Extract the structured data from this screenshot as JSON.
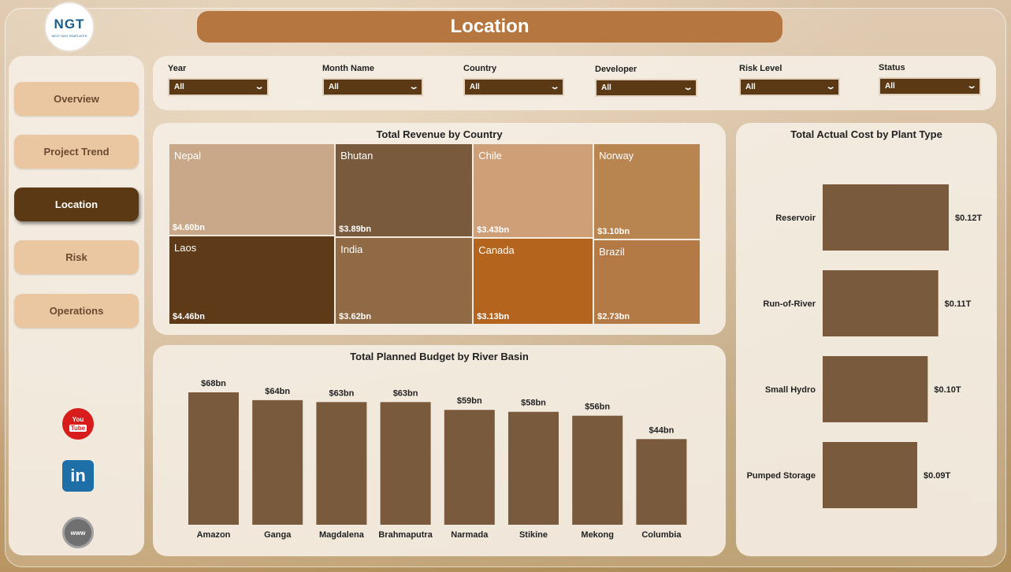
{
  "logo": {
    "text": "NGT",
    "subtext": "NEXT GEN TEMPLATES"
  },
  "header": {
    "title": "Location"
  },
  "sidebar": {
    "items": [
      {
        "label": "Overview",
        "active": false
      },
      {
        "label": "Project Trend",
        "active": false
      },
      {
        "label": "Location",
        "active": true
      },
      {
        "label": "Risk",
        "active": false
      },
      {
        "label": "Operations",
        "active": false
      }
    ],
    "social": [
      {
        "name": "youtube-icon",
        "line1": "You",
        "line2": "Tube"
      },
      {
        "name": "linkedin-icon",
        "text": "in"
      },
      {
        "name": "website-icon",
        "text": "www"
      }
    ]
  },
  "filters": [
    {
      "label": "Year",
      "value": "All"
    },
    {
      "label": "Month Name",
      "value": "All"
    },
    {
      "label": "Country",
      "value": "All"
    },
    {
      "label": "Developer",
      "value": "All"
    },
    {
      "label": "Risk Level",
      "value": "All"
    },
    {
      "label": "Status",
      "value": "All"
    }
  ],
  "colors": {
    "accent": "#5c3915",
    "title_bar": "#b5763f",
    "bar": "#7a5a3c"
  },
  "chart_data": [
    {
      "type": "treemap",
      "title": "Total Revenue by Country",
      "items": [
        {
          "name": "Nepal",
          "value": 4.6,
          "label": "$4.60bn",
          "color": "#c8a888"
        },
        {
          "name": "Bhutan",
          "value": 3.89,
          "label": "$3.89bn",
          "color": "#7a5a3c"
        },
        {
          "name": "Chile",
          "value": 3.43,
          "label": "$3.43bn",
          "color": "#cfa078"
        },
        {
          "name": "Norway",
          "value": 3.1,
          "label": "$3.10bn",
          "color": "#b88450"
        },
        {
          "name": "Laos",
          "value": 4.46,
          "label": "$4.46bn",
          "color": "#5e3a18"
        },
        {
          "name": "India",
          "value": 3.62,
          "label": "$3.62bn",
          "color": "#906a45"
        },
        {
          "name": "Canada",
          "value": 3.13,
          "label": "$3.13bn",
          "color": "#b5641d"
        },
        {
          "name": "Brazil",
          "value": 2.73,
          "label": "$2.73bn",
          "color": "#b47a45"
        }
      ]
    },
    {
      "type": "bar",
      "title": "Total Planned Budget by River Basin",
      "categories": [
        "Amazon",
        "Ganga",
        "Magdalena",
        "Brahmaputra",
        "Narmada",
        "Stikine",
        "Mekong",
        "Columbia"
      ],
      "values": [
        68,
        64,
        63,
        63,
        59,
        58,
        56,
        44
      ],
      "labels": [
        "$68bn",
        "$64bn",
        "$63bn",
        "$63bn",
        "$59bn",
        "$58bn",
        "$56bn",
        "$44bn"
      ],
      "ylim": [
        0,
        68
      ]
    },
    {
      "type": "bar",
      "orientation": "horizontal",
      "title": "Total Actual Cost by Plant Type",
      "categories": [
        "Reservoir",
        "Run-of-River",
        "Small Hydro",
        "Pumped Storage"
      ],
      "values": [
        0.12,
        0.11,
        0.1,
        0.09
      ],
      "labels": [
        "$0.12T",
        "$0.11T",
        "$0.10T",
        "$0.09T"
      ],
      "xlim": [
        0,
        0.12
      ]
    }
  ]
}
